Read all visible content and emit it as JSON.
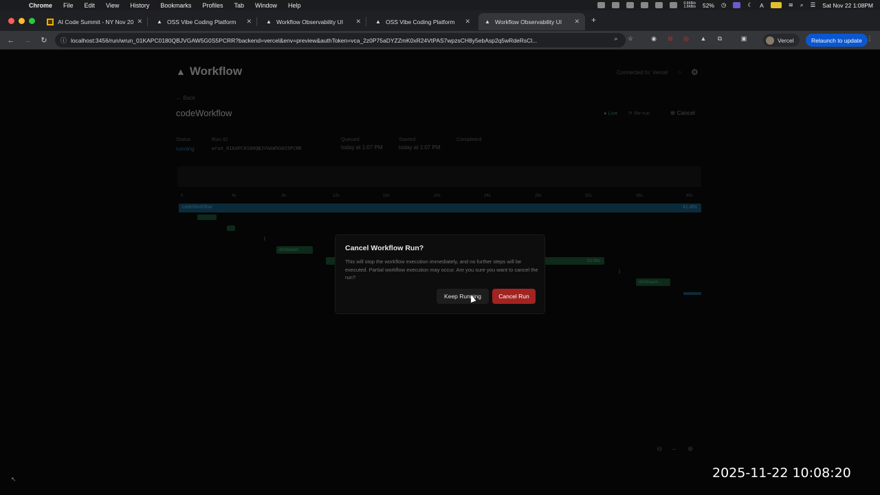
{
  "menubar": {
    "app": "Chrome",
    "items": [
      "File",
      "Edit",
      "View",
      "History",
      "Bookmarks",
      "Profiles",
      "Tab",
      "Window",
      "Help"
    ],
    "net_up": "0.6KB/s",
    "net_down": "1.5KB/s",
    "battery_pct": "52%",
    "datetime": "Sat Nov 22  1:08PM"
  },
  "tabs": [
    {
      "title": "AI Code Summit - NY Nov 20",
      "icon": "calendar-icon"
    },
    {
      "title": "OSS Vibe Coding Platform",
      "icon": "vercel-triangle-icon"
    },
    {
      "title": "Workflow Observability UI",
      "icon": "vercel-triangle-icon"
    },
    {
      "title": "OSS Vibe Coding Platform",
      "icon": "vercel-triangle-icon"
    },
    {
      "title": "Workflow Observability UI",
      "icon": "vercel-triangle-icon",
      "active": true
    }
  ],
  "toolbar": {
    "url": "localhost:3456/run/wrun_01KAPC0180QBJVGAW5G0S5PCRR?backend=vercel&env=preview&authToken=vca_2z0P75aDYZZmK0xR24VtPAS7wpzsCH8y5ebAsp2q5wRdeRsCl...",
    "profile_label": "Vercel",
    "relaunch_label": "Relaunch to update"
  },
  "app": {
    "logo": "Workflow",
    "connection": "Connected to: Vercel",
    "back": "Back",
    "title": "codeWorkflow",
    "live": "Live",
    "rerun": "Re-run",
    "cancel": "Cancel",
    "meta": {
      "status_label": "Status",
      "status_value": "running",
      "runid_label": "Run ID",
      "runid_value": "wrun_01KAPC0180QBJVGAW5G0S5PCRR",
      "queued_label": "Queued",
      "queued_value": "today at 1:07 PM",
      "started_label": "Started",
      "started_value": "today at 1:07 PM",
      "completed_label": "Completed"
    },
    "ticks": [
      "0",
      "4s",
      "8s",
      "12s",
      "16s",
      "20s",
      "24s",
      "28s",
      "32s",
      "36s",
      "40s"
    ],
    "main_bar": {
      "label": "codeWorkflow",
      "duration": "41.46s"
    },
    "steps": [
      {
        "label": "doStream"
      },
      {
        "label": "23.09s"
      },
      {
        "label": "doStream..."
      }
    ]
  },
  "modal": {
    "title": "Cancel Workflow Run?",
    "body": "This will stop the workflow execution immediately, and no further steps will be executed. Partial workflow execution may occur. Are you sure you want to cancel the run?",
    "keep_label": "Keep Running",
    "cancel_label": "Cancel Run"
  },
  "overlay_timestamp": "2025-11-22  10:08:20"
}
